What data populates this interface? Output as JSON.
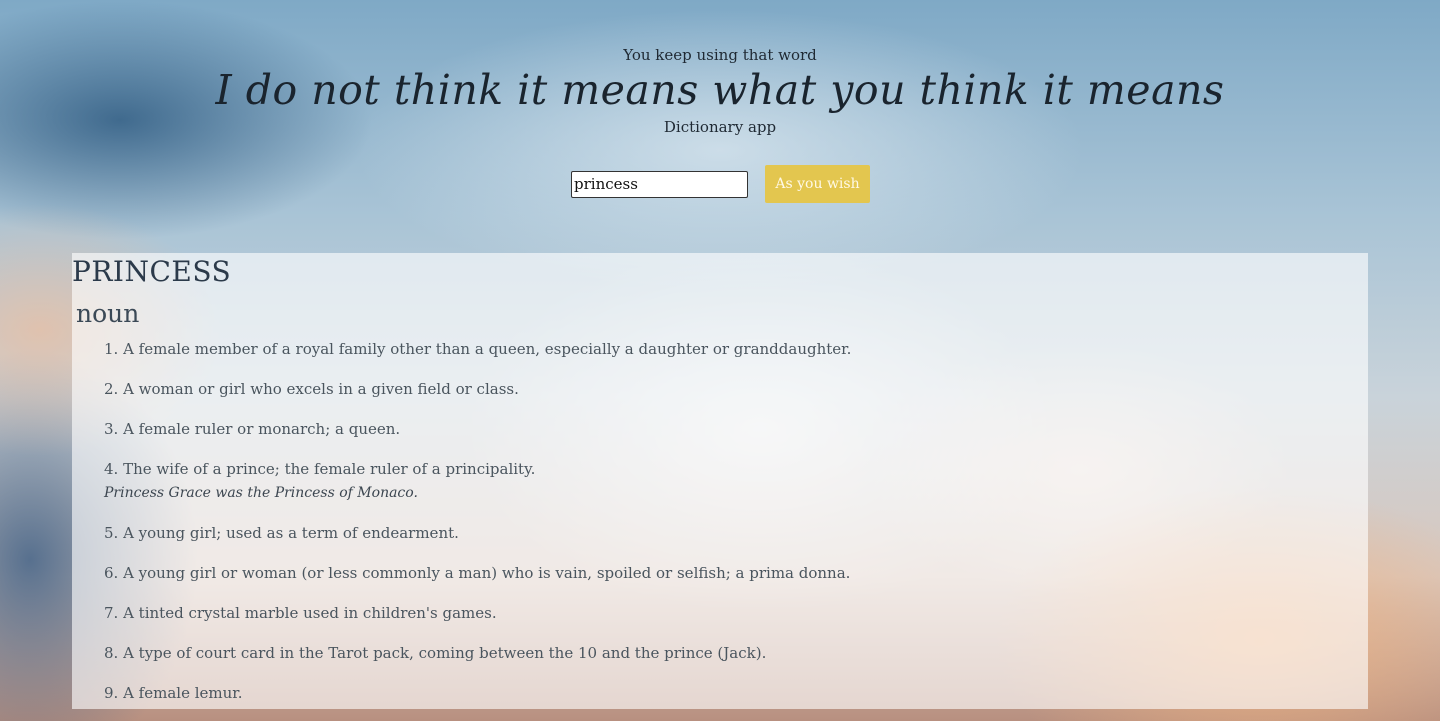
{
  "header": {
    "tagline": "You keep using that word",
    "title": "I do not think it means what you think it means",
    "subtitle": "Dictionary app"
  },
  "search": {
    "value": "princess",
    "button_label": "As you wish"
  },
  "result": {
    "word": "PRINCESS",
    "part_of_speech": "noun",
    "definitions": [
      {
        "text": "1. A female member of a royal family other than a queen, especially a daughter or granddaughter.",
        "example": ""
      },
      {
        "text": "2. A woman or girl who excels in a given field or class.",
        "example": ""
      },
      {
        "text": "3. A female ruler or monarch; a queen.",
        "example": ""
      },
      {
        "text": "4. The wife of a prince; the female ruler of a principality.",
        "example": "Princess Grace was the Princess of Monaco."
      },
      {
        "text": "5. A young girl; used as a term of endearment.",
        "example": ""
      },
      {
        "text": "6. A young girl or woman (or less commonly a man) who is vain, spoiled or selfish; a prima donna.",
        "example": ""
      },
      {
        "text": "7. A tinted crystal marble used in children's games.",
        "example": ""
      },
      {
        "text": "8. A type of court card in the Tarot pack, coming between the 10 and the prince (Jack).",
        "example": ""
      },
      {
        "text": "9. A female lemur.",
        "example": ""
      }
    ]
  },
  "colors": {
    "button_bg": "#e3c64f",
    "text_dark": "#1a242e",
    "panel_bg": "rgba(255,255,255,0.62)"
  }
}
